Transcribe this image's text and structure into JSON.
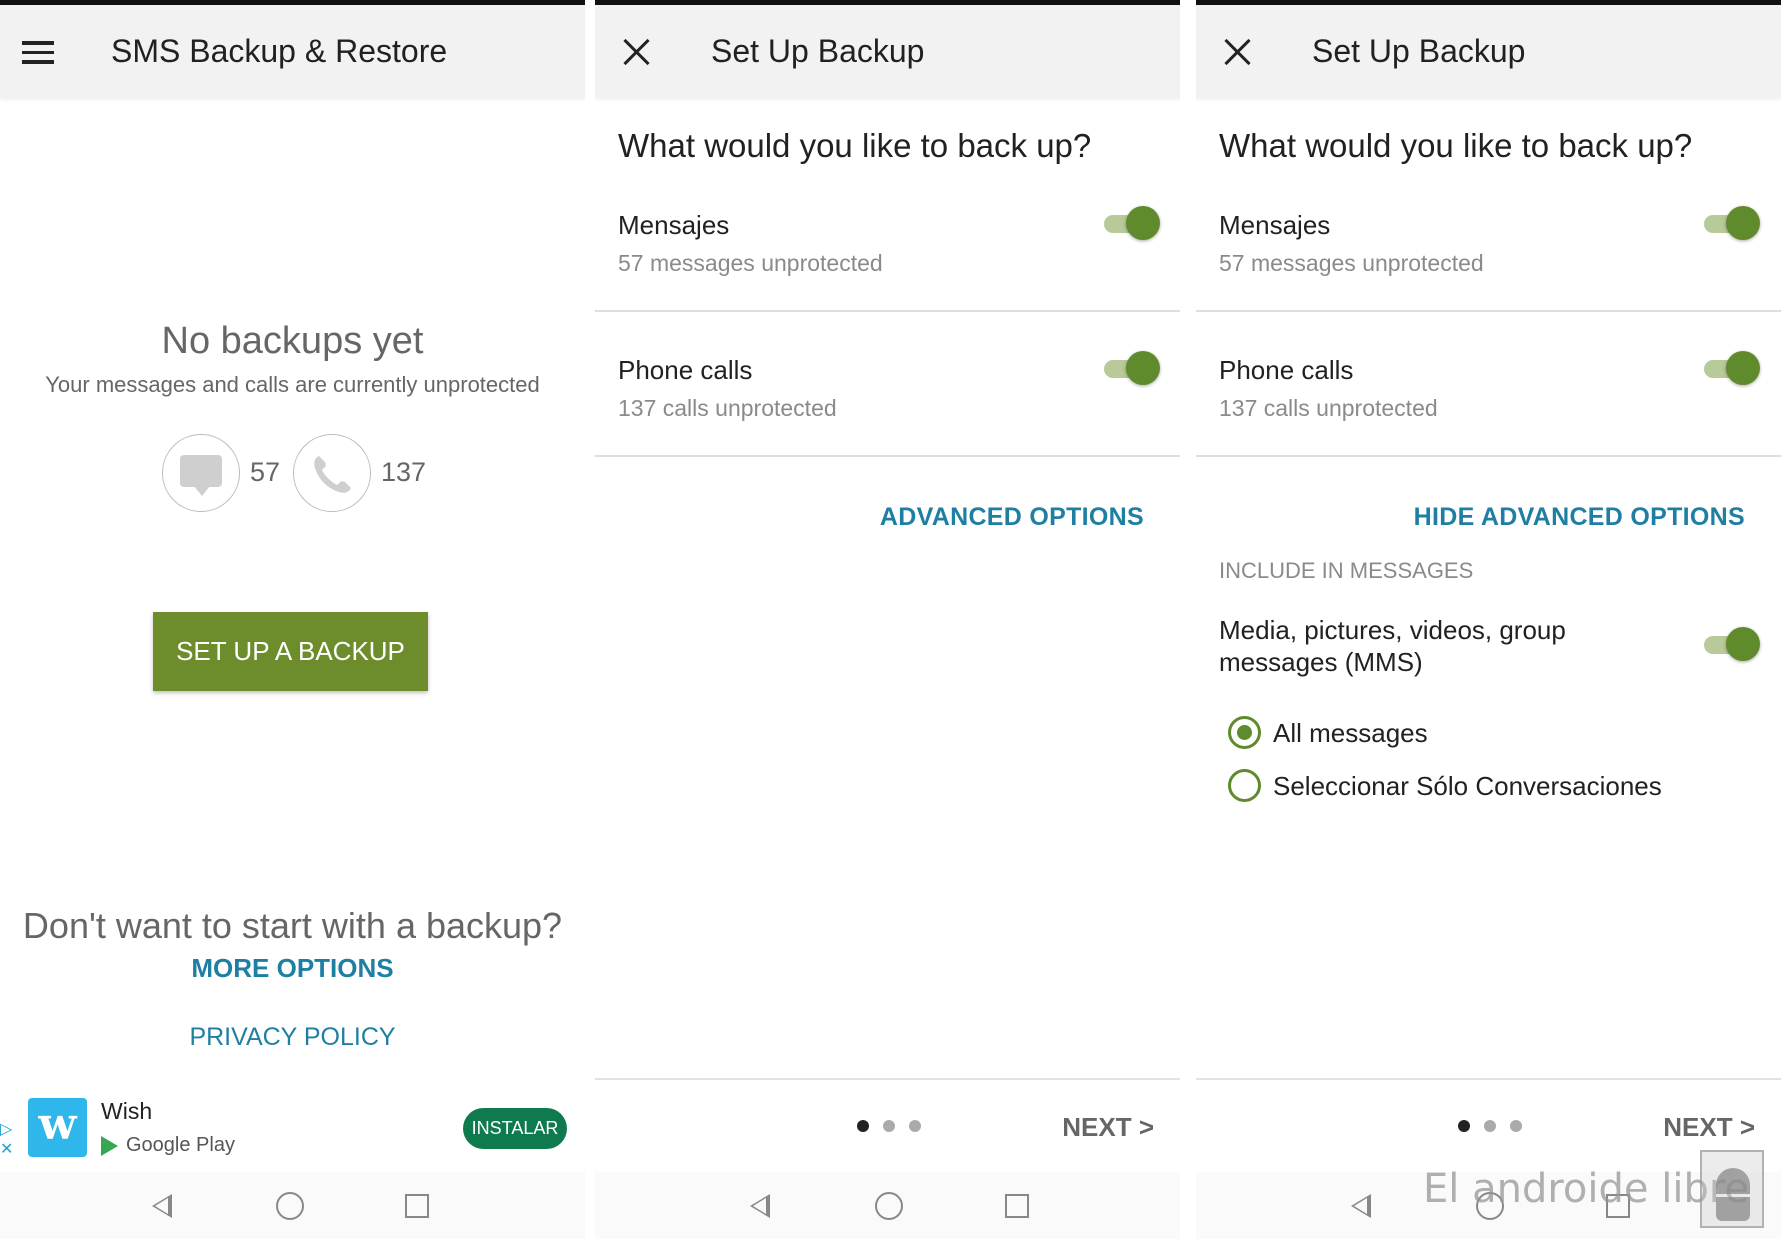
{
  "screen1": {
    "title": "SMS Backup & Restore",
    "empty_heading": "No backups yet",
    "empty_subtitle": "Your messages and calls are currently unprotected",
    "message_count": "57",
    "call_count": "137",
    "setup_button": "SET UP A BACKUP",
    "no_backup_question": "Don't want to start with a backup?",
    "more_options": "MORE OPTIONS",
    "privacy_policy": "PRIVACY POLICY",
    "ad": {
      "app_name": "Wish",
      "store": "Google Play",
      "install_button": "INSTALAR",
      "logo_letter": "w"
    }
  },
  "screen2": {
    "title": "Set Up Backup",
    "question": "What would you like to back up?",
    "messages_label": "Mensajes",
    "messages_status": "57 messages unprotected",
    "messages_toggle": true,
    "calls_label": "Phone calls",
    "calls_status": "137 calls unprotected",
    "calls_toggle": true,
    "advanced_options": "ADVANCED OPTIONS",
    "page_indicator": {
      "current": 1,
      "total": 3
    },
    "next": "NEXT >"
  },
  "screen3": {
    "title": "Set Up Backup",
    "question": "What would you like to back up?",
    "messages_label": "Mensajes",
    "messages_status": "57 messages unprotected",
    "messages_toggle": true,
    "calls_label": "Phone calls",
    "calls_status": "137 calls unprotected",
    "calls_toggle": true,
    "hide_advanced_options": "HIDE ADVANCED OPTIONS",
    "include_caption": "INCLUDE IN MESSAGES",
    "mms_label": "Media, pictures, videos, group messages (MMS)",
    "mms_toggle": true,
    "radio_options": [
      {
        "label": "All messages",
        "selected": true
      },
      {
        "label": "Seleccionar Sólo Conversaciones",
        "selected": false
      }
    ],
    "page_indicator": {
      "current": 1,
      "total": 3
    },
    "next": "NEXT >"
  },
  "watermark": "El androide libre",
  "colors": {
    "accent_green": "#6d8d2d",
    "toggle_green": "#5f8b2c",
    "link_blue": "#1e7fa3",
    "appbar_bg": "#f2f2f2",
    "ad_install_green": "#0f7a4d"
  },
  "icons": [
    "menu-icon",
    "close-icon",
    "message-bubble-icon",
    "phone-icon",
    "ad-choices-icon",
    "google-play-icon",
    "back-nav-icon",
    "home-nav-icon",
    "recents-nav-icon"
  ]
}
